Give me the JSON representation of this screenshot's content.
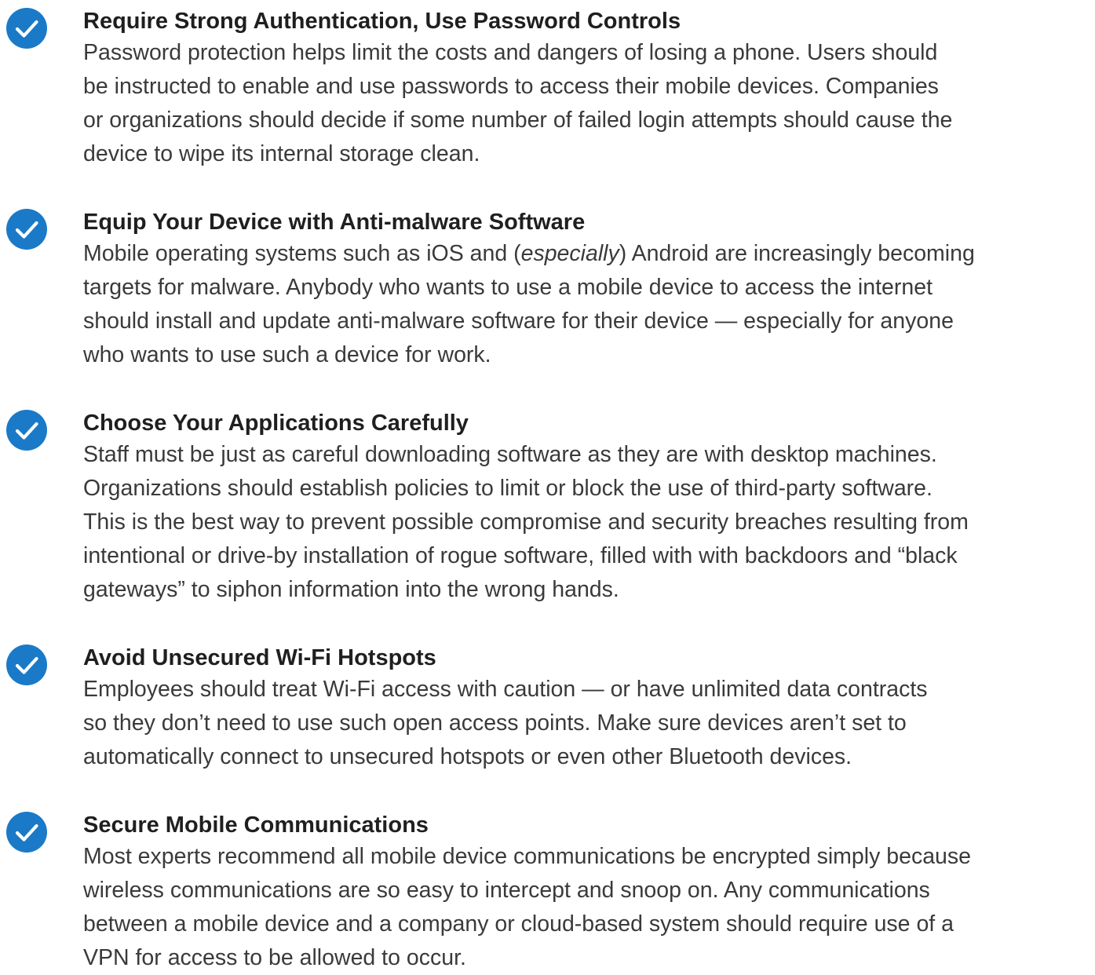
{
  "colors": {
    "check_fill": "#1a7ac8",
    "check_mark": "#ffffff",
    "title_text": "#1f1f1f",
    "body_text": "#3a3a3a"
  },
  "items": [
    {
      "icon": "check-circle-icon",
      "title": "Require Strong Authentication, Use Password Controls",
      "lines": [
        "Password protection helps limit the costs and dangers of losing a phone. Users should",
        "be instructed to enable and use passwords to access their mobile devices. Companies",
        "or organizations should decide if some number of failed login attempts should cause the",
        "device to wipe its internal storage clean."
      ]
    },
    {
      "icon": "check-circle-icon",
      "title": "Equip Your Device with Anti-malware Software",
      "line1_pre": "Mobile operating systems such as iOS and (",
      "line1_em": "especially",
      "line1_post": ") Android are increasingly becoming",
      "lines": [
        "targets for malware. Anybody who wants to use a mobile device to access the internet",
        "should install and update anti-malware software for their device — especially for anyone",
        "who wants to use such a device for work."
      ]
    },
    {
      "icon": "check-circle-icon",
      "title": "Choose Your Applications Carefully",
      "lines": [
        "Staff must be just as careful downloading software as they are with desktop machines.",
        "Organizations should establish policies to limit or block the use of third-party software.",
        "This is the best way to prevent possible compromise and security breaches resulting from",
        "intentional or drive-by installation of rogue software, filled with with backdoors and “black",
        "gateways” to siphon information into the wrong hands."
      ]
    },
    {
      "icon": "check-circle-icon",
      "title": "Avoid Unsecured Wi-Fi Hotspots",
      "lines": [
        "Employees should treat Wi-Fi access with caution — or have unlimited data contracts",
        "so they don’t need to use such open access points. Make sure devices aren’t set to",
        "automatically connect to unsecured hotspots or even other Bluetooth devices."
      ]
    },
    {
      "icon": "check-circle-icon",
      "title": "Secure Mobile Communications",
      "lines": [
        "Most experts recommend all mobile device communications be encrypted simply because",
        "wireless communications are so easy to intercept and snoop on. Any communications",
        "between a mobile device and a company or cloud-based system should require use of a",
        "VPN for access to be allowed to occur."
      ]
    }
  ]
}
